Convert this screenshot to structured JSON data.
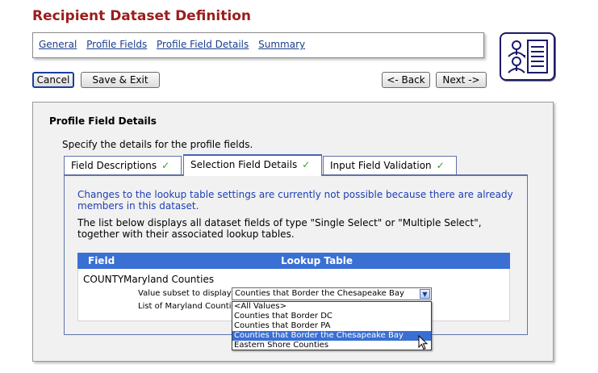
{
  "header": {
    "title": "Recipient Dataset Definition"
  },
  "nav": {
    "links": [
      "General",
      "Profile Fields",
      "Profile Field Details",
      "Summary"
    ]
  },
  "toolbar": {
    "cancel_label": "Cancel",
    "save_exit_label": "Save & Exit",
    "back_label": "<- Back",
    "next_label": "Next ->"
  },
  "logo": {
    "icon": "recipient-dataset-icon"
  },
  "section": {
    "title": "Profile Field Details",
    "description": "Specify the details for the profile fields."
  },
  "tabs": [
    {
      "label": "Field Descriptions",
      "check": "✓"
    },
    {
      "label": "Selection Field Details",
      "check": "✓"
    },
    {
      "label": "Input Field Validation",
      "check": "✓"
    }
  ],
  "panel": {
    "message": "Changes to the lookup table settings are currently not possible because there are already members in this dataset.",
    "text": "The list below displays all dataset fields of type \"Single Select\" or \"Multiple Select\", together with their associated lookup tables."
  },
  "grid": {
    "columns": [
      "Field",
      "Lookup Table"
    ],
    "rows": [
      {
        "field": "COUNTY",
        "lookup": "Maryland Counties",
        "subset_label": "Value subset to display:",
        "list_label": "List of Maryland Counties"
      }
    ]
  },
  "select": {
    "value": "Counties that Border the Chesapeake Bay",
    "options": [
      "<All Values>",
      "Counties that Border DC",
      "Counties that Border PA",
      "Counties that Border the Chesapeake Bay",
      "Eastern Shore Counties"
    ],
    "highlighted_index": 3
  },
  "colors": {
    "title": "#9b1d1d",
    "link": "#1a3e8c",
    "message": "#1c3fb5",
    "grid_header": "#3a6fd3",
    "check": "#3a9a2a"
  }
}
